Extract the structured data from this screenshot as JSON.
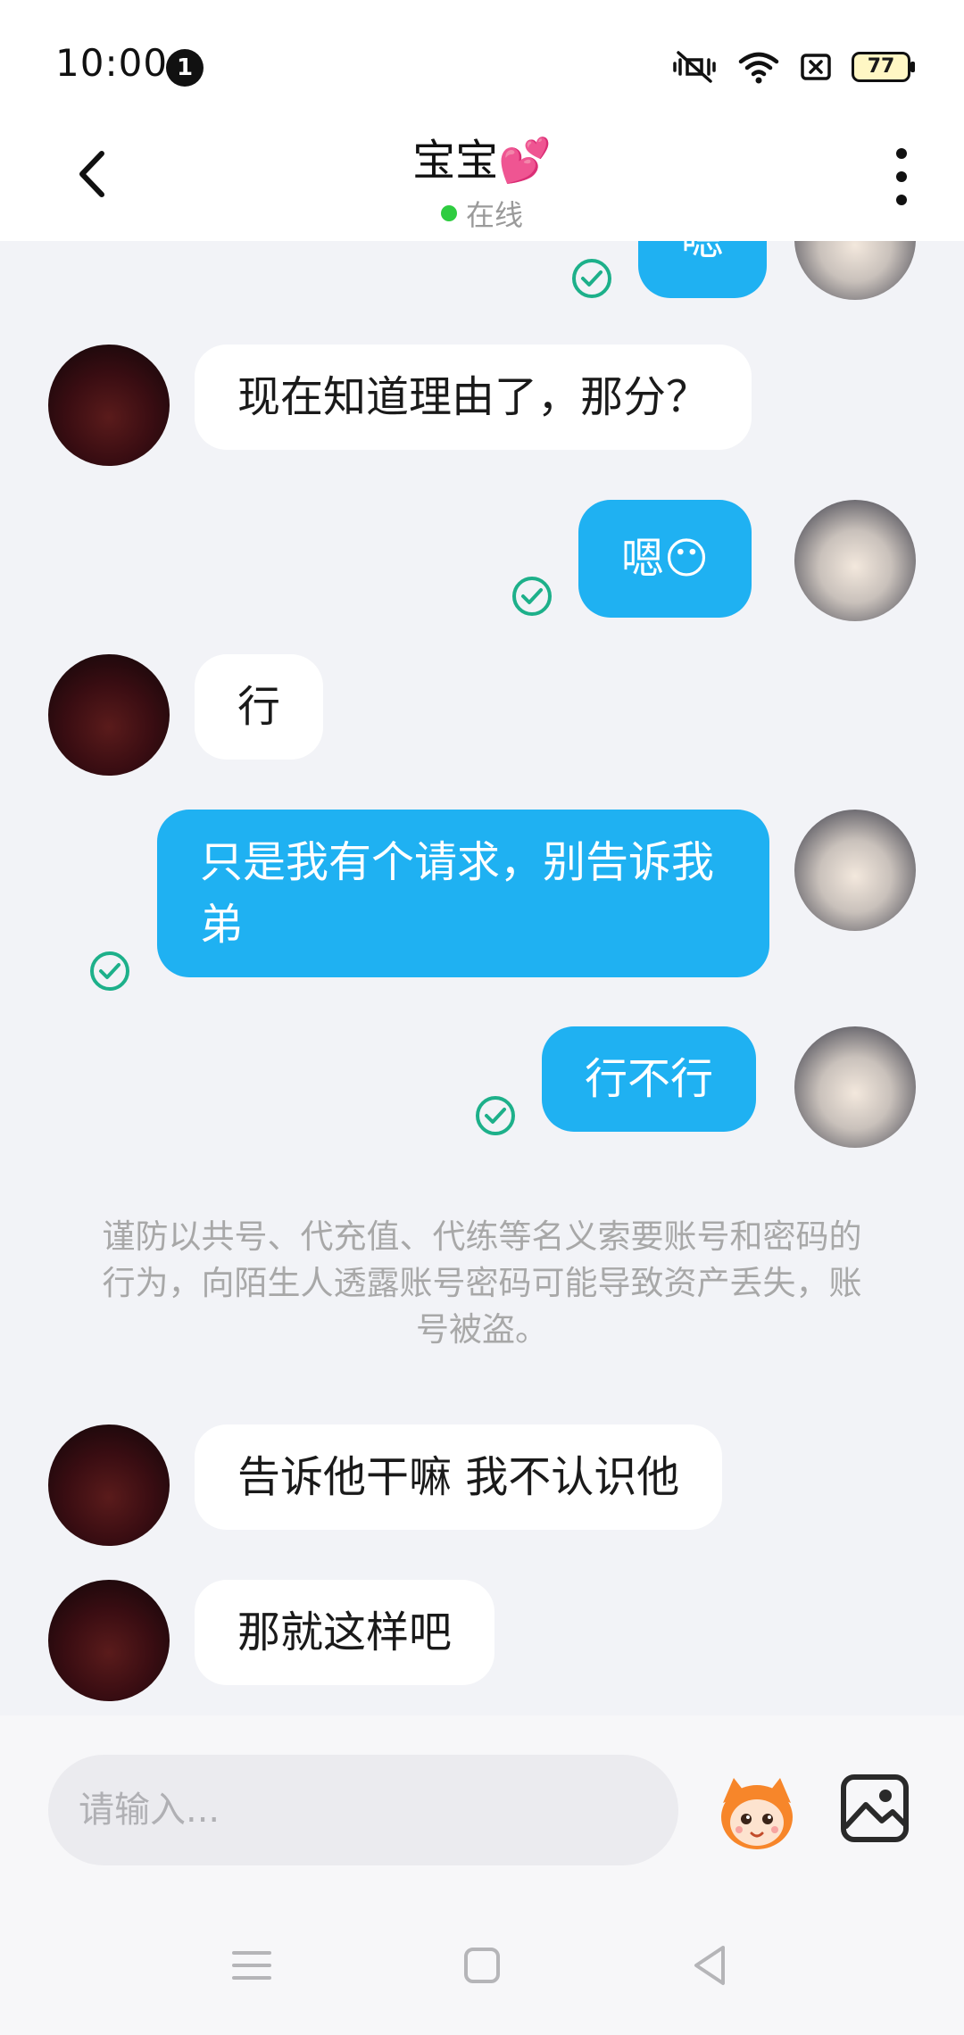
{
  "status_bar": {
    "time": "10:00",
    "notification_count": "1",
    "battery": "77"
  },
  "header": {
    "title": "宝宝💕",
    "status": "在线"
  },
  "messages": [
    {
      "from": "self",
      "text": "嗯",
      "read": true
    },
    {
      "from": "other",
      "text": "现在知道理由了，那分？"
    },
    {
      "from": "self",
      "text": "嗯😶",
      "read": true
    },
    {
      "from": "other",
      "text": "行"
    },
    {
      "from": "self",
      "text": "只是我有个请求，别告诉我弟",
      "read": true
    },
    {
      "from": "self",
      "text": "行不行",
      "read": true
    },
    {
      "from": "other",
      "text": "告诉他干嘛 我不认识他"
    },
    {
      "from": "other",
      "text": "那就这样吧"
    }
  ],
  "warning": "谨防以共号、代充值、代练等名义索要账号和密码的行为，向陌生人透露账号密码可能导致资产丢失，账号被盗。",
  "input": {
    "placeholder": "请输入..."
  },
  "colors": {
    "self_bubble": "#1fb1f2",
    "other_bubble": "#ffffff",
    "chat_background": "#f2f3f7",
    "online": "#2ecc40",
    "read_check": "#1db08a"
  }
}
